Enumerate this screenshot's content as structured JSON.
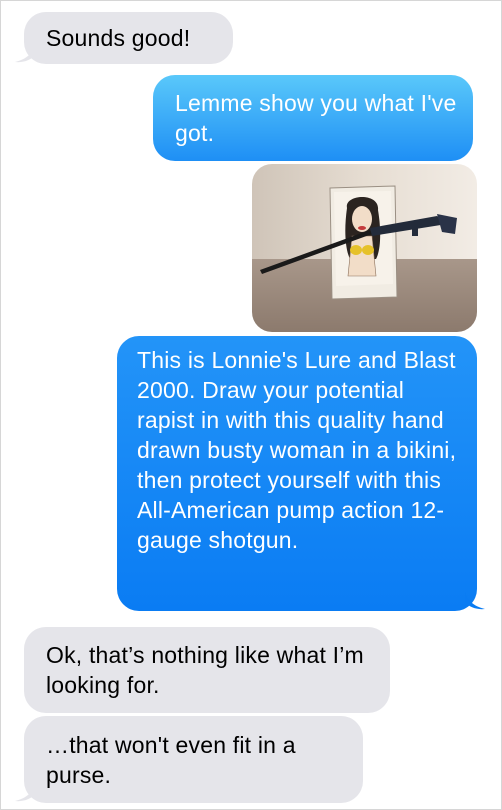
{
  "conversation": {
    "messages": [
      {
        "direction": "incoming",
        "text": "Sounds good!"
      },
      {
        "direction": "outgoing",
        "text": "Lemme show you what I've got."
      },
      {
        "direction": "outgoing",
        "type": "image",
        "image_subject": "photo of a shotgun barrel through a hand-drawn picture of a woman in a bikini on cardboard"
      },
      {
        "direction": "outgoing",
        "text": "This is Lonnie's Lure and Blast 2000. Draw your potential rapist in with this quality hand drawn busty woman in a bikini, then protect yourself with this All-American pump action 12-gauge shotgun."
      },
      {
        "direction": "incoming",
        "text": "Ok, that’s nothing like what I’m looking for."
      },
      {
        "direction": "incoming",
        "text": "…that won't even fit in a purse."
      }
    ]
  },
  "colors": {
    "incoming_bubble": "#e5e5ea",
    "outgoing_bubble_top": "#5ac8fa",
    "outgoing_bubble_bottom": "#0a7cf3",
    "background": "#ffffff"
  }
}
